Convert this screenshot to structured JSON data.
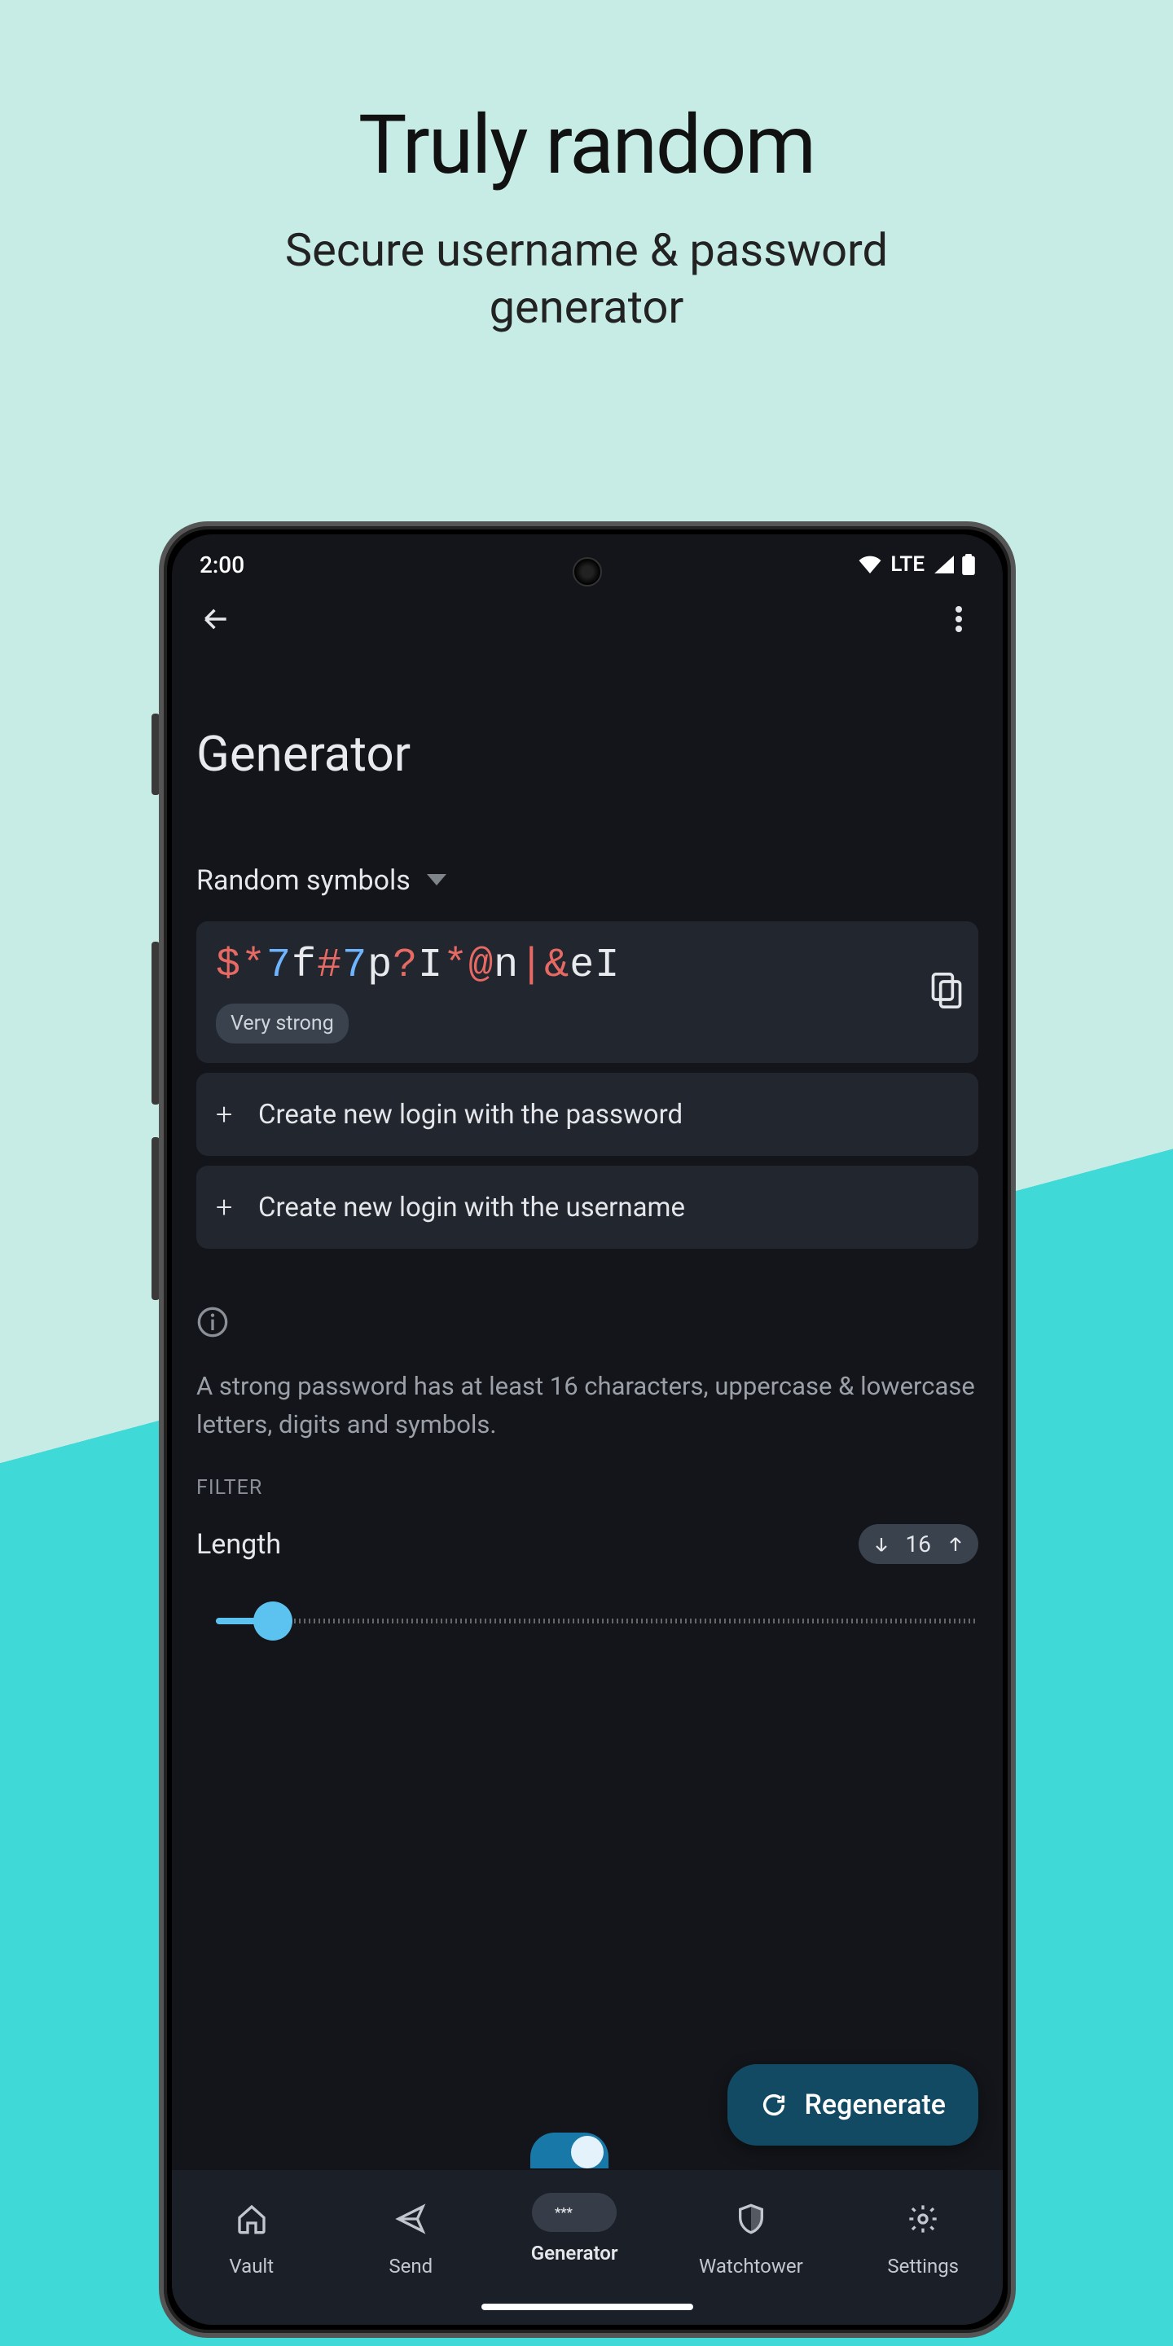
{
  "promo": {
    "title": "Truly random",
    "subtitle_line1": "Secure username & password",
    "subtitle_line2": "generator"
  },
  "status": {
    "time": "2:00",
    "network": "LTE"
  },
  "app": {
    "page_title": "Generator",
    "mode_label": "Random symbols",
    "password_chars": [
      {
        "c": "$",
        "t": "sym"
      },
      {
        "c": "*",
        "t": "sym"
      },
      {
        "c": "7",
        "t": "num"
      },
      {
        "c": "f",
        "t": "let"
      },
      {
        "c": "#",
        "t": "sym"
      },
      {
        "c": "7",
        "t": "num"
      },
      {
        "c": "p",
        "t": "let"
      },
      {
        "c": "?",
        "t": "sym"
      },
      {
        "c": "I",
        "t": "let"
      },
      {
        "c": "*",
        "t": "sym"
      },
      {
        "c": "@",
        "t": "sym"
      },
      {
        "c": "n",
        "t": "let"
      },
      {
        "c": "|",
        "t": "sym"
      },
      {
        "c": "&",
        "t": "sym"
      },
      {
        "c": "e",
        "t": "let"
      },
      {
        "c": "I",
        "t": "let"
      }
    ],
    "strength": "Very strong",
    "actions": {
      "create_pw": "Create new login with the password",
      "create_un": "Create new login with the username"
    },
    "info_text": "A strong password has at least 16 characters, uppercase & lowercase letters, digits and symbols.",
    "filter_label": "FILTER",
    "length_label": "Length",
    "length_value": "16",
    "regenerate_label": "Regenerate"
  },
  "nav": {
    "items": [
      {
        "label": "Vault"
      },
      {
        "label": "Send"
      },
      {
        "label": "Generator"
      },
      {
        "label": "Watchtower"
      },
      {
        "label": "Settings"
      }
    ]
  }
}
